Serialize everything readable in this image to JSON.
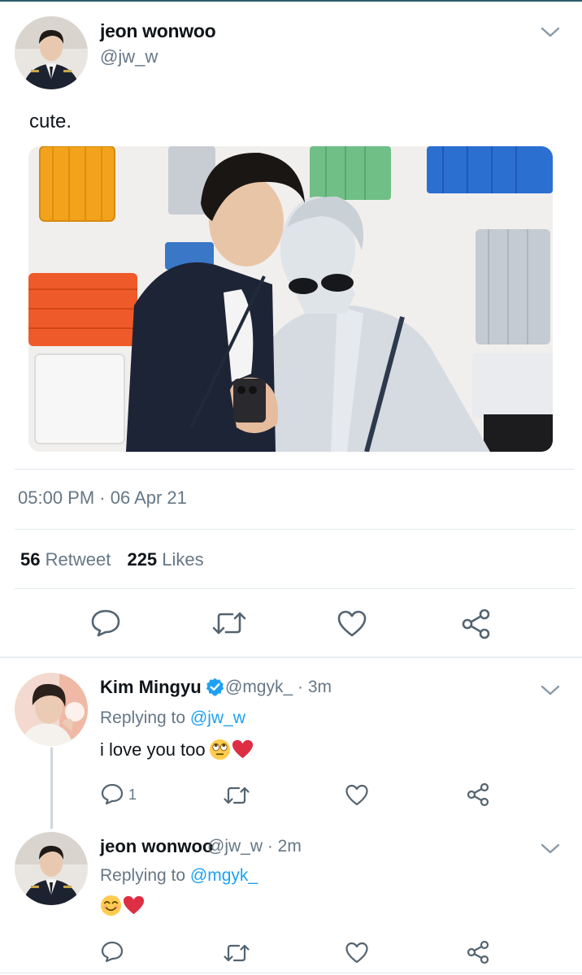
{
  "main_tweet": {
    "author_name": "jeon wonwoo",
    "author_handle": "@jw_w",
    "text": "cute.",
    "timestamp": "05:00 PM · 06 Apr 21",
    "retweets_count": "56",
    "retweets_label": "Retweet",
    "likes_count": "225",
    "likes_label": "Likes",
    "actions": [
      "reply-icon",
      "retweet-icon",
      "like-icon",
      "share-icon"
    ]
  },
  "replies": [
    {
      "author_name": "Kim Mingyu",
      "verified": true,
      "author_handle": "@mgyk_",
      "time": "· 3m",
      "replying_prefix": "Replying to",
      "replying_to": "@jw_w",
      "text": "i love you too",
      "emojis": [
        "eye-roll-emoji",
        "red-heart-emoji"
      ],
      "reply_count": "1"
    },
    {
      "author_name": "jeon wonwoo",
      "verified": false,
      "author_handle": "@jw_w",
      "time": "· 2m",
      "replying_prefix": "Replying to",
      "replying_to": "@mgyk_",
      "text": "",
      "emojis": [
        "smiling-emoji",
        "red-heart-emoji"
      ],
      "reply_count": ""
    }
  ],
  "colors": {
    "link": "#1da1f2",
    "muted": "#657786",
    "divider": "#e1e8ed",
    "verified": "#1da1f2",
    "heart": "#e0245e"
  }
}
